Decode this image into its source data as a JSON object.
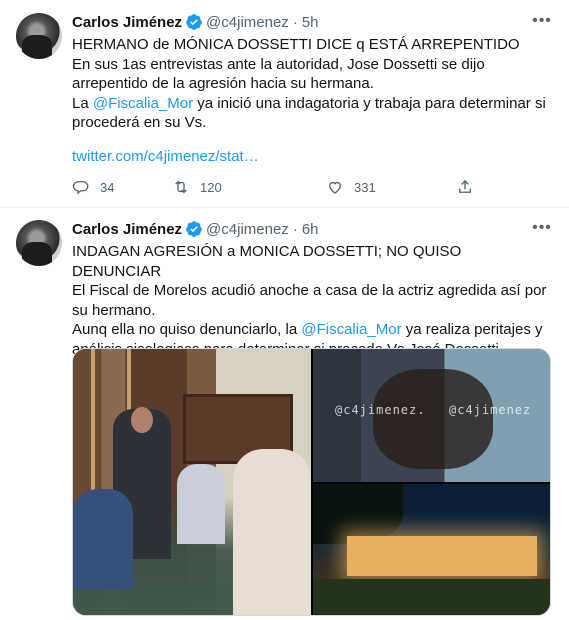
{
  "tweets": [
    {
      "name": "Carlos Jiménez",
      "handle": "@c4jimenez",
      "dot": "·",
      "time": "5h",
      "lines": [
        "HERMANO de MÓNICA DOSSETTI DICE q ESTÁ ARREPENTIDO",
        "En sus 1as  entrevistas ante la autoridad, Jose Dossetti se dijo arrepentido de la agresión hacia su hermana."
      ],
      "line3_pre": "La ",
      "line3_mention": "@Fiscalia_Mor",
      "line3_post": " ya inició una indagatoria y trabaja para determinar si procederá en su Vs.",
      "url": "twitter.com/c4jimenez/stat…",
      "replies": "34",
      "retweets": "120",
      "likes": "331"
    },
    {
      "name": "Carlos Jiménez",
      "handle": "@c4jimenez",
      "dot": "·",
      "time": "6h",
      "line1": "INDAGAN AGRESIÓN a MONICA DOSSETTI; NO QUISO DENUNCIAR",
      "line2": "El Fiscal de Morelos acudió anoche a casa de la actriz agredida así por su hermano.",
      "line3_pre": "Aunq ella no quiso denunciarlo, la ",
      "line3_mention": "@Fiscalia_Mor",
      "line3_post": " ya realiza peritajes y análisis sicologicos para determinar si procede Vs José Dossetti.",
      "watermark_1": "@c4jimenez.",
      "watermark_2": "@c4jimenez"
    }
  ],
  "icons": {
    "verified": "verified-badge-icon",
    "more": "more-dots-icon",
    "reply": "reply-icon",
    "retweet": "retweet-icon",
    "like": "heart-icon",
    "share": "share-icon"
  },
  "colors": {
    "accent": "#1d9bf0",
    "secondary_text": "#536471",
    "primary_text": "#0f1419"
  }
}
